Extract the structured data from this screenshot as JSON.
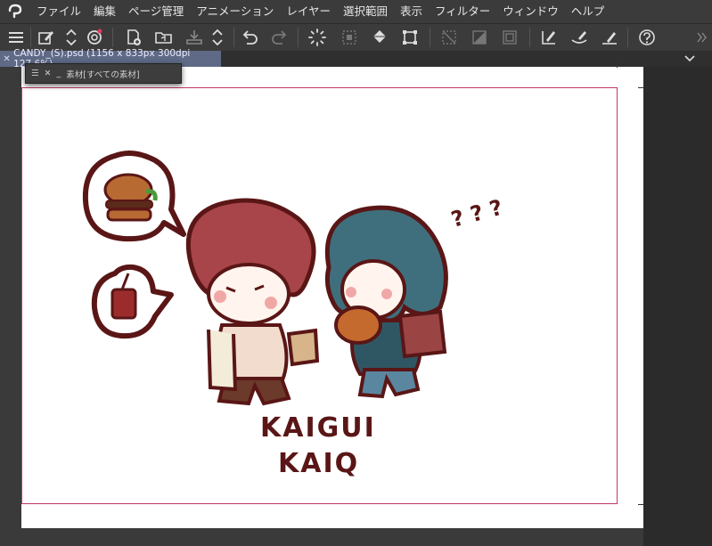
{
  "menubar": {
    "items": [
      "ファイル",
      "編集",
      "ページ管理",
      "アニメーション",
      "レイヤー",
      "選択範囲",
      "表示",
      "フィルター",
      "ウィンドウ",
      "ヘルプ"
    ]
  },
  "document": {
    "tab_title": "CANDY_(S).psd (1156 x 833px 300dpi 127.6%)"
  },
  "material_panel": {
    "title": "素材[すべての素材]"
  },
  "artwork": {
    "text_line1": "KAIGUI",
    "text_line2": "KAIQ",
    "question_marks": "? ? ?"
  },
  "colors": {
    "ui_dark": "#3b3b3b",
    "tab_active": "#5e6a86",
    "frame_border": "#c0386b",
    "ink": "#5a1616",
    "hair_red": "#a8454a",
    "hair_teal": "#3f6f7d"
  }
}
